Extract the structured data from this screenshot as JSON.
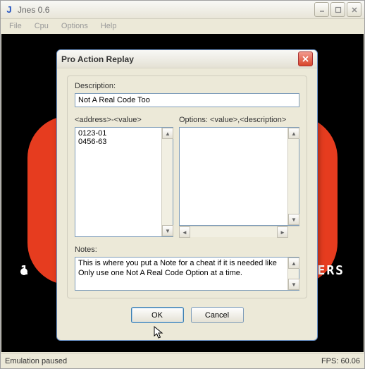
{
  "window": {
    "title": "Jnes 0.6",
    "icon_letter": "J"
  },
  "menu": {
    "items": [
      "File",
      "Cpu",
      "Options",
      "Help"
    ]
  },
  "game": {
    "left_text": "1",
    "right_text": "ERS"
  },
  "status": {
    "left": "Emulation paused",
    "right": "FPS: 60.06"
  },
  "dialog": {
    "title": "Pro Action Replay",
    "description_label": "Description:",
    "description_value": "Not A Real Code Too",
    "addr_header": "<address>-<value>",
    "options_header": "Options: <value>,<description>",
    "addr_list": [
      "0123-01",
      "0456-63"
    ],
    "notes_label": "Notes:",
    "notes_value": "This is where you put a Note for a cheat if it is needed like Only use one Not A Real Code Option at a time.",
    "ok_label": "OK",
    "cancel_label": "Cancel"
  }
}
